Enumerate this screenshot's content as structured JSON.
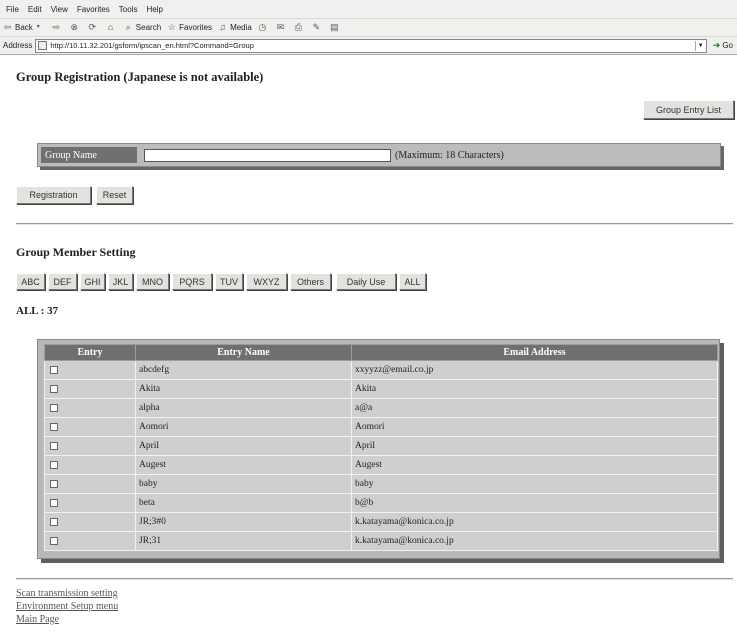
{
  "browser": {
    "menu": [
      "File",
      "Edit",
      "View",
      "Favorites",
      "Tools",
      "Help"
    ],
    "toolbar": {
      "back": "Back",
      "search": "Search",
      "favorites": "Favorites",
      "media": "Media"
    },
    "address_label": "Address",
    "url": "http://10.11.32.201/gsform/ipscan_en.html?Command=Group",
    "go_label": "Go"
  },
  "page": {
    "title": "Group Registration (Japanese is not available)",
    "group_entry_list_button": "Group Entry List",
    "group_name_label": "Group Name",
    "group_name_value": "",
    "group_name_hint": "(Maximum: 18 Characters)",
    "registration_button": "Registration",
    "reset_button": "Reset",
    "member_setting_title": "Group Member Setting",
    "filter_tabs": [
      "ABC",
      "DEF",
      "GHI",
      "JKL",
      "MNO",
      "PQRS",
      "TUV",
      "WXYZ",
      "Others",
      "Daily Use",
      "ALL"
    ],
    "count_text": "ALL : 37",
    "table": {
      "headers": [
        "Entry",
        "Entry Name",
        "Email Address"
      ],
      "rows": [
        {
          "name": "abcdefg",
          "email": "xxyyzz@email.co.jp"
        },
        {
          "name": "Akita",
          "email": "Akita"
        },
        {
          "name": "alpha",
          "email": "a@a"
        },
        {
          "name": "Aomori",
          "email": "Aomori"
        },
        {
          "name": "April",
          "email": "April"
        },
        {
          "name": "Augest",
          "email": "Augest"
        },
        {
          "name": "baby",
          "email": "baby"
        },
        {
          "name": "beta",
          "email": "b@b"
        },
        {
          "name": "JR;3#0",
          "email": "k.katayama@konica.co.jp"
        },
        {
          "name": "JR;31",
          "email": "k.katayama@konica.co.jp"
        }
      ]
    },
    "footer_links": [
      "Scan transmission setting",
      "Environment Setup menu",
      "Main Page"
    ]
  }
}
